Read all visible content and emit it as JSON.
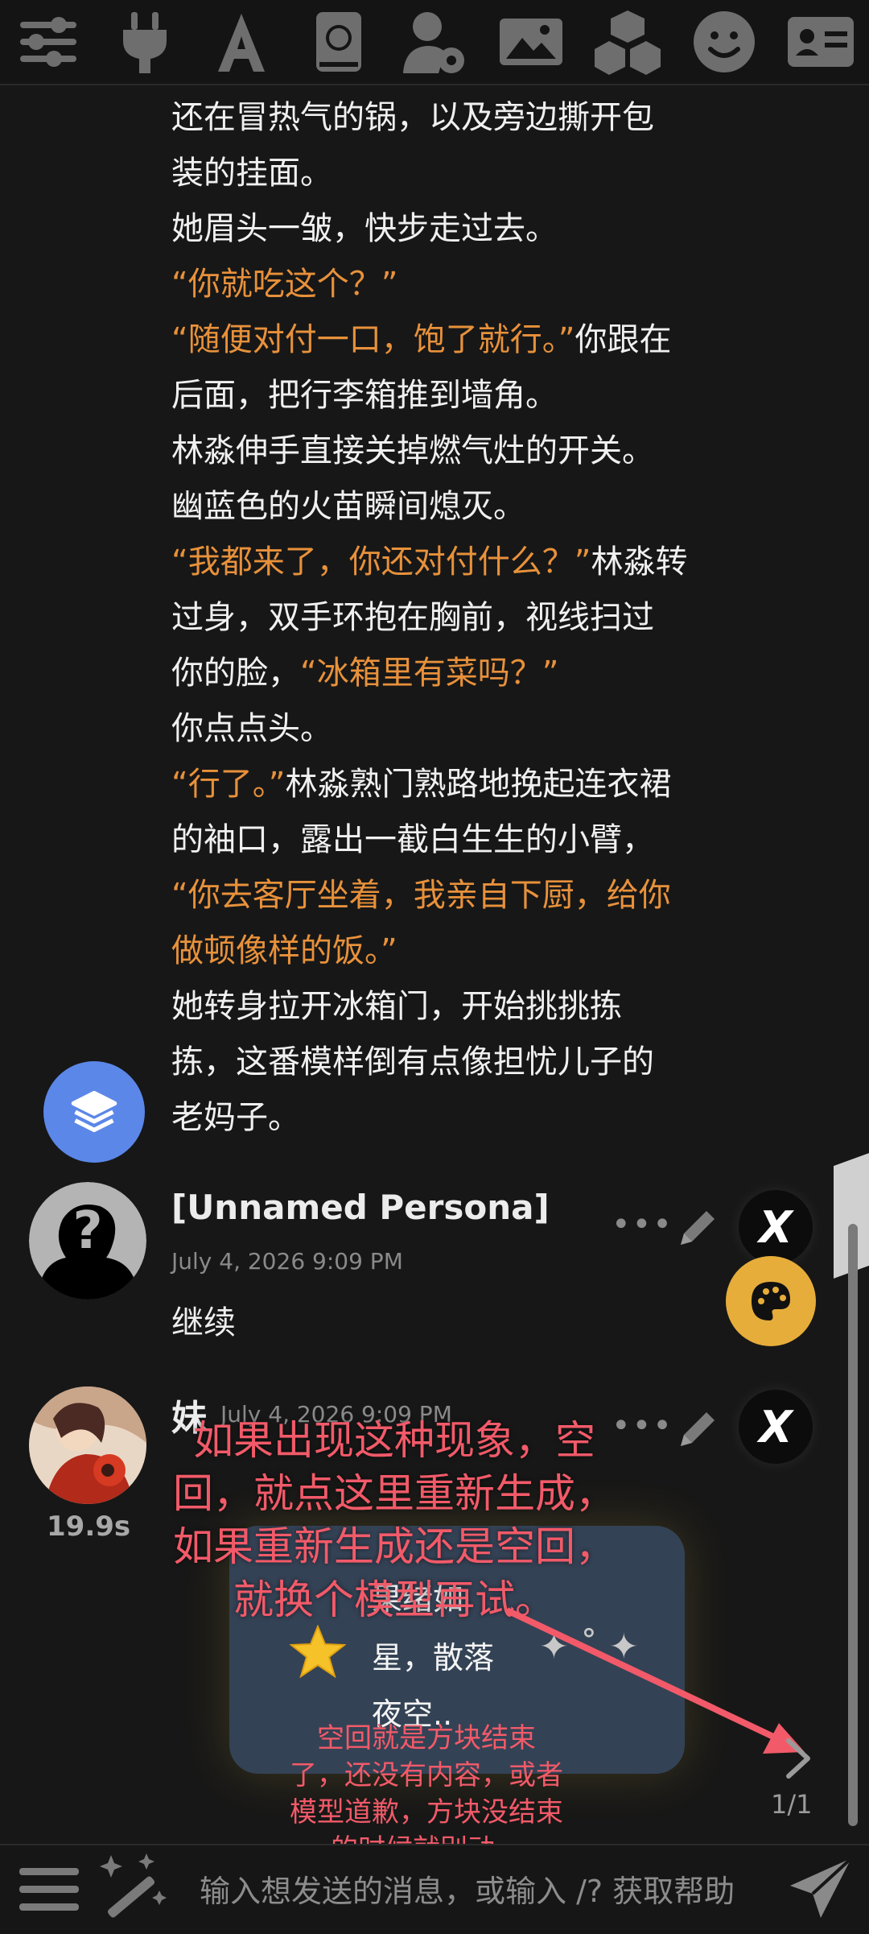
{
  "toolbar": {
    "icons": [
      "sliders-icon",
      "plug-icon",
      "font-icon",
      "book-globe-icon",
      "user-gear-icon",
      "image-icon",
      "cubes-icon",
      "smiley-icon",
      "id-card-icon"
    ]
  },
  "story": {
    "lines": [
      [
        {
          "t": "还在冒热气的锅，以及旁边撕开包",
          "q": false
        }
      ],
      [
        {
          "t": "装的挂面。",
          "q": false
        }
      ],
      [
        {
          "t": "她眉头一皱，快步走过去。",
          "q": false
        }
      ],
      [
        {
          "t": "“你就吃这个？”",
          "q": true
        }
      ],
      [
        {
          "t": "“随便对付一口，饱了就行。”",
          "q": true
        },
        {
          "t": "你跟在",
          "q": false
        }
      ],
      [
        {
          "t": "后面，把行李箱推到墙角。",
          "q": false
        }
      ],
      [
        {
          "t": "林淼伸手直接关掉燃气灶的开关。",
          "q": false
        }
      ],
      [
        {
          "t": "幽蓝色的火苗瞬间熄灭。",
          "q": false
        }
      ],
      [
        {
          "t": "“我都来了，你还对付什么？”",
          "q": true
        },
        {
          "t": "林淼转",
          "q": false
        }
      ],
      [
        {
          "t": "过身，双手环抱在胸前，视线扫过",
          "q": false
        }
      ],
      [
        {
          "t": "你的脸，",
          "q": false
        },
        {
          "t": "“冰箱里有菜吗？”",
          "q": true
        }
      ],
      [
        {
          "t": "你点点头。",
          "q": false
        }
      ],
      [
        {
          "t": "“行了。”",
          "q": true
        },
        {
          "t": "林淼熟门熟路地挽起连衣裙",
          "q": false
        }
      ],
      [
        {
          "t": "的袖口，露出一截白生生的小臂，",
          "q": false
        }
      ],
      [
        {
          "t": "“你去客厅坐着，我亲自下厨，给你",
          "q": true
        }
      ],
      [
        {
          "t": "做顿像样的饭。”",
          "q": true
        }
      ],
      [
        {
          "t": "她转身拉开冰箱门，开始挑挑拣",
          "q": false
        }
      ],
      [
        {
          "t": "拣，这番模样倒有点像担忧儿子的",
          "q": false
        }
      ],
      [
        {
          "t": "老妈子。",
          "q": false
        }
      ]
    ]
  },
  "message1": {
    "name": "[Unnamed Persona]",
    "date": "July 4, 2026 9:09 PM",
    "text": "继续",
    "avatar": "unknown-persona-avatar"
  },
  "message2": {
    "name": "妹",
    "date": "July 4, 2026 9:09 PM",
    "timer": "19.9s",
    "avatar": "character-avatar"
  },
  "loading_card": {
    "line1": "果绪如",
    "line2": "星，散落",
    "line3": "夜空.."
  },
  "annotation": {
    "big": [
      "如果出现这种现象，空",
      "回，就点这里重新生成，",
      "如果重新生成还是空回，",
      "就换个模型再试。"
    ],
    "small": [
      "空回就是方块结束",
      "了，还没有内容，或者",
      "模型道歉，方块没结束",
      "的时候就别动。"
    ],
    "color": "#f25a69"
  },
  "pager": {
    "label": "1/1"
  },
  "input": {
    "placeholder": "输入想发送的消息，或输入 /? 获取帮助"
  },
  "colors": {
    "accent_quote": "#e8913b",
    "layers_button": "#5b87e8",
    "palette_button": "#e7ad3a"
  }
}
